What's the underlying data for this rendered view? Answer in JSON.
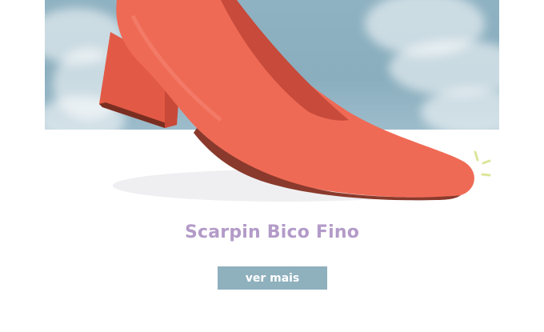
{
  "product": {
    "title": "Scarpin Bico Fino",
    "image_label": "red-pointed-toe-pump"
  },
  "cta": {
    "label": "ver mais"
  },
  "colors": {
    "sky": "#8fb2c2",
    "shoe": "#ef6a55",
    "title": "#b39bc8",
    "button": "#8fb0bd",
    "sparkle": "#dce59a"
  }
}
